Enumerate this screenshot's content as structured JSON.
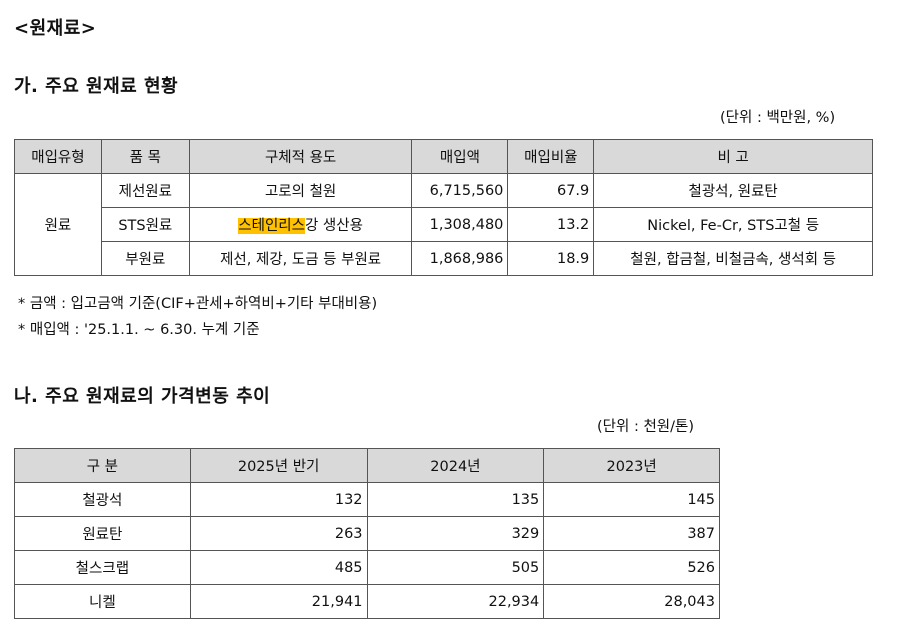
{
  "section_title": "<원재료>",
  "part_a": {
    "heading": "가. 주요 원재료 현황",
    "unit": "(단위 : 백만원, %)",
    "headers": [
      "매입유형",
      "품 목",
      "구체적 용도",
      "매입액",
      "매입비율",
      "비 고"
    ],
    "group_label": "원료",
    "rows": [
      {
        "item": "제선원료",
        "use": "고로의 철원",
        "amount": "6,715,560",
        "ratio": "67.9",
        "note": "철광석, 원료탄"
      },
      {
        "item": "STS원료",
        "use_highlight": "스테인리스",
        "use_rest": "강 생산용",
        "amount": "1,308,480",
        "ratio": "13.2",
        "note": "Nickel, Fe-Cr, STS고철 등"
      },
      {
        "item": "부원료",
        "use": "제선, 제강, 도금 등 부원료",
        "amount": "1,868,986",
        "ratio": "18.9",
        "note": "철원, 합금철, 비철금속, 생석회 등"
      }
    ],
    "notes": [
      "* 금액 : 입고금액 기준(CIF+관세+하역비+기타 부대비용)",
      "* 매입액 : '25.1.1. ~ 6.30. 누계 기준"
    ]
  },
  "part_b": {
    "heading": "나. 주요 원재료의 가격변동 추이",
    "unit": "(단위 : 천원/톤)",
    "headers": [
      "구 분",
      "2025년 반기",
      "2024년",
      "2023년"
    ],
    "rows": [
      {
        "name": "철광석",
        "v2025": "132",
        "v2024": "135",
        "v2023": "145"
      },
      {
        "name": "원료탄",
        "v2025": "263",
        "v2024": "329",
        "v2023": "387"
      },
      {
        "name": "철스크랩",
        "v2025": "485",
        "v2024": "505",
        "v2023": "526"
      },
      {
        "name": "니켈",
        "v2025": "21,941",
        "v2024": "22,934",
        "v2023": "28,043"
      }
    ]
  }
}
